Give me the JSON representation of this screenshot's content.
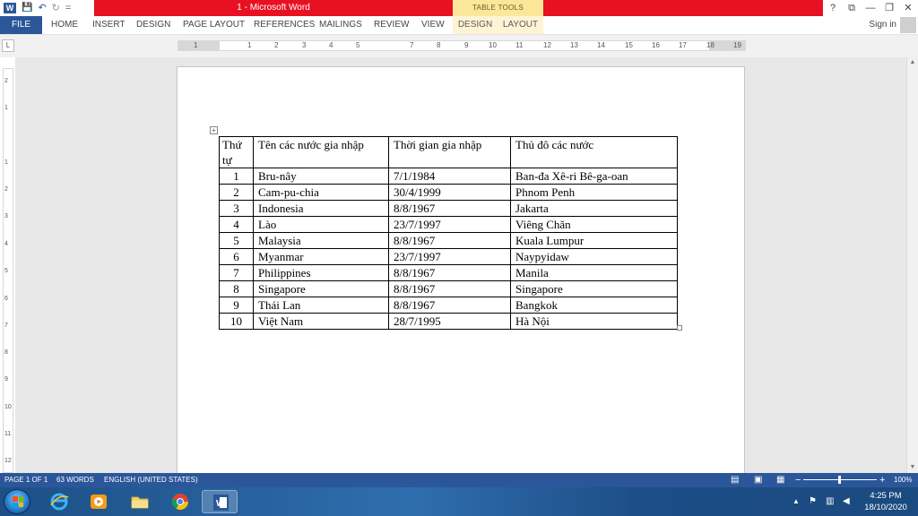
{
  "titlebar": {
    "title": "1 -  Microsoft Word",
    "context_group": "TABLE TOOLS",
    "help": "?",
    "restore_ribbon": "⧉",
    "minimize": "—",
    "maximize": "❐",
    "close": "✕"
  },
  "quick_access": {
    "word_logo": "W",
    "save": "💾",
    "undo": "↶",
    "redo": "↻",
    "customize": "="
  },
  "ribbon": {
    "tabs": [
      "FILE",
      "HOME",
      "INSERT",
      "DESIGN",
      "PAGE LAYOUT",
      "REFERENCES",
      "MAILINGS",
      "REVIEW",
      "VIEW",
      "DESIGN",
      "LAYOUT"
    ],
    "sign_in": "Sign in"
  },
  "ruler": {
    "tab_selector": "L",
    "numbers": [
      "1",
      "1",
      "2",
      "3",
      "4",
      "5",
      "7",
      "8",
      "9",
      "10",
      "11",
      "12",
      "13",
      "14",
      "15",
      "16",
      "17",
      "18",
      "19"
    ],
    "vertical_numbers": [
      "2",
      "1",
      "1",
      "2",
      "3",
      "4",
      "5",
      "6",
      "7",
      "8",
      "9",
      "10",
      "11",
      "12"
    ]
  },
  "table": {
    "headers": [
      "Thứ tự",
      "Tên các nước gia nhập",
      "Thời gian gia nhập",
      "Thủ đô các nước"
    ],
    "rows": [
      [
        "1",
        "Bru-nây",
        "7/1/1984",
        "Ban-đa Xê-ri Bê-ga-oan"
      ],
      [
        "2",
        "Cam-pu-chia",
        "30/4/1999",
        "Phnom Penh"
      ],
      [
        "3",
        "Indonesia",
        "8/8/1967",
        "Jakarta"
      ],
      [
        "4",
        "Lào",
        "23/7/1997",
        "Viêng Chăn"
      ],
      [
        "5",
        "Malaysia",
        "8/8/1967",
        "Kuala Lumpur"
      ],
      [
        "6",
        "Myanmar",
        "23/7/1997",
        "Naypyidaw"
      ],
      [
        "7",
        "Philippines",
        "8/8/1967",
        "Manila"
      ],
      [
        "8",
        "Singapore",
        "8/8/1967",
        "Singapore"
      ],
      [
        "9",
        "Thái Lan",
        "8/8/1967",
        "Bangkok"
      ],
      [
        "10",
        "Việt Nam",
        "28/7/1995",
        "Hà Nội"
      ]
    ]
  },
  "statusbar": {
    "page": "PAGE 1 OF 1",
    "words": "63 WORDS",
    "language": "ENGLISH (UNITED STATES)",
    "zoom_minus": "−",
    "zoom_plus": "+",
    "zoom": "100%"
  },
  "taskbar": {
    "time": "4:25 PM",
    "date": "18/10/2020",
    "apps": [
      "windows-explorer-icon",
      "internet-explorer-icon",
      "media-player-icon",
      "file-explorer-icon",
      "chrome-icon",
      "word-icon"
    ]
  },
  "colors": {
    "word_blue": "#2b579a",
    "title_red": "#e81123",
    "table_tools": "#fce69a"
  }
}
